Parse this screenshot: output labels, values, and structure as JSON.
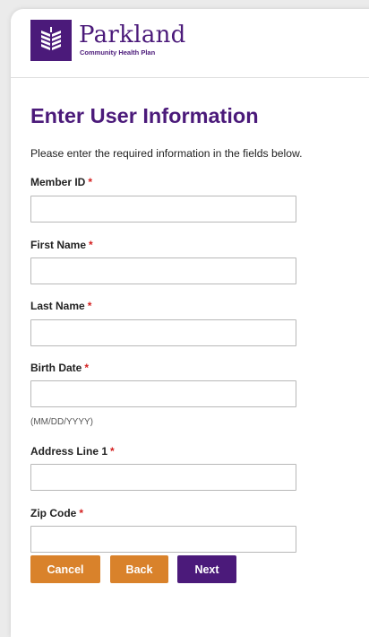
{
  "header": {
    "logo_name": "Parkland",
    "logo_subtitle": "Community Health Plan",
    "logo_icon": "parkland-logo-icon"
  },
  "form": {
    "title": "Enter User Information",
    "intro": "Please enter the required information in the fields below.",
    "required_marker": "*",
    "fields": [
      {
        "label": "Member ID",
        "value": ""
      },
      {
        "label": "First Name",
        "value": ""
      },
      {
        "label": "Last Name",
        "value": ""
      },
      {
        "label": "Birth Date",
        "value": "",
        "hint": "(MM/DD/YYYY)"
      },
      {
        "label": "Address Line 1",
        "value": ""
      },
      {
        "label": "Zip Code",
        "value": ""
      }
    ]
  },
  "buttons": {
    "cancel": "Cancel",
    "back": "Back",
    "next": "Next"
  },
  "colors": {
    "brand_purple": "#4b1a7a",
    "accent_orange": "#d9822b",
    "required_red": "#d42020"
  }
}
